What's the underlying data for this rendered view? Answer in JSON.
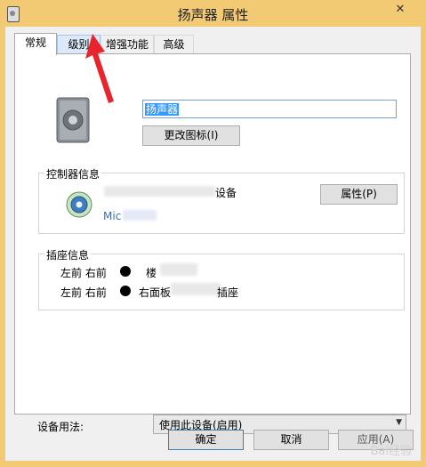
{
  "window": {
    "title": "扬声器 属性",
    "close_glyph": "✕"
  },
  "tabs": [
    {
      "label": "常规"
    },
    {
      "label": "级别"
    },
    {
      "label": "增强功能"
    },
    {
      "label": "高级"
    }
  ],
  "general": {
    "device_name": "扬声器",
    "change_icon_button": "更改图标(I)"
  },
  "controller_info": {
    "title": "控制器信息",
    "device_suffix": "设备",
    "vendor_partial": "Mic",
    "properties_button": "属性(P)"
  },
  "jack_info": {
    "title": "插座信息",
    "rows": [
      {
        "label": "左前 右前",
        "text": "楼"
      },
      {
        "label": "左前 右前",
        "text_before": "右面板",
        "text_after": "插座"
      }
    ]
  },
  "usage": {
    "label": "设备用法:",
    "selected": "使用此设备(启用)"
  },
  "buttons": {
    "ok": "确定",
    "cancel": "取消",
    "apply": "应用(A)"
  },
  "watermark": "Bai经验",
  "colors": {
    "frame": "#f3ca74",
    "selection": "#3399ff",
    "annotation_arrow": "#e8252c"
  }
}
